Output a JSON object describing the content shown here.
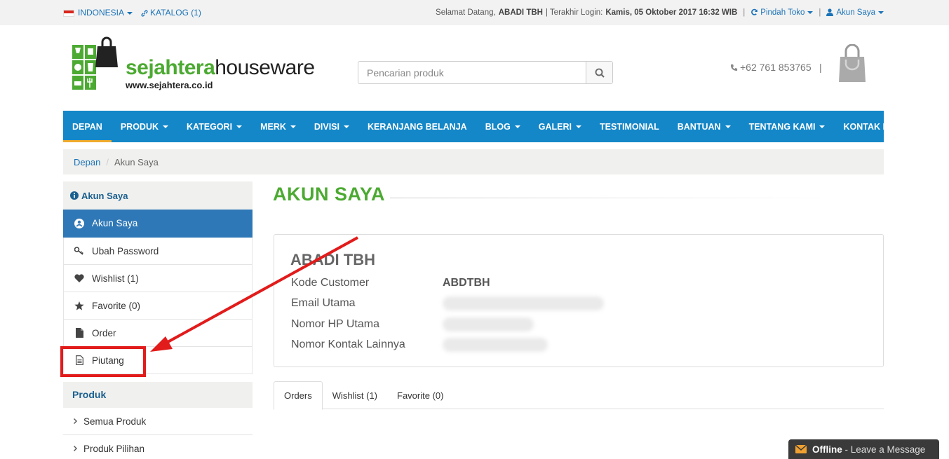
{
  "topbar": {
    "language": "INDONESIA",
    "catalog": "KATALOG (1)",
    "welcome_prefix": "Selamat Datang,",
    "user_name": "ABADI TBH",
    "login_prefix": "| Terakhir Login:",
    "login_time": "Kamis, 05 Oktober 2017 16:32 WIB",
    "switch_store": "Pindah Toko",
    "account": "Akun Saya"
  },
  "header": {
    "logo_green": "sejahtera",
    "logo_dark": "houseware",
    "logo_url": "www.sejahtera.co.id",
    "search_placeholder": "Pencarian produk",
    "phone": "+62 761 853765",
    "divider": "|"
  },
  "nav": [
    {
      "label": "DEPAN",
      "caret": false,
      "active": true
    },
    {
      "label": "PRODUK",
      "caret": true
    },
    {
      "label": "KATEGORI",
      "caret": true
    },
    {
      "label": "MERK",
      "caret": true
    },
    {
      "label": "DIVISI",
      "caret": true
    },
    {
      "label": "KERANJANG BELANJA",
      "caret": false
    },
    {
      "label": "BLOG",
      "caret": true
    },
    {
      "label": "GALERI",
      "caret": true
    },
    {
      "label": "TESTIMONIAL",
      "caret": false
    },
    {
      "label": "BANTUAN",
      "caret": true
    },
    {
      "label": "TENTANG KAMI",
      "caret": true
    },
    {
      "label": "KONTAK KAMI",
      "caret": false
    }
  ],
  "breadcrumb": {
    "home": "Depan",
    "separator": "/",
    "current": "Akun Saya"
  },
  "sidebar": {
    "title": "Akun Saya",
    "items": [
      {
        "label": "Akun Saya",
        "icon": "user-circle-icon"
      },
      {
        "label": "Ubah Password",
        "icon": "key-icon"
      },
      {
        "label": "Wishlist (1)",
        "icon": "heart-icon"
      },
      {
        "label": "Favorite (0)",
        "icon": "star-icon"
      },
      {
        "label": "Order",
        "icon": "file-icon"
      },
      {
        "label": "Piutang",
        "icon": "document-text-icon"
      }
    ],
    "products_title": "Produk",
    "product_items": [
      "Semua Produk",
      "Produk Pilihan"
    ]
  },
  "main": {
    "title": "AKUN SAYA",
    "customer_name": "ABADI TBH",
    "fields": {
      "code_label": "Kode Customer",
      "code_value": "ABDTBH",
      "email_label": "Email Utama",
      "phone_label": "Nomor HP Utama",
      "other_label": "Nomor Kontak Lainnya"
    },
    "tabs": [
      "Orders",
      "Wishlist (1)",
      "Favorite (0)"
    ]
  },
  "chat": {
    "status": "Offline",
    "message": " - Leave a Message"
  },
  "colors": {
    "primary": "#1487c8",
    "green": "#4caa32",
    "annotation": "#e21b1b"
  }
}
